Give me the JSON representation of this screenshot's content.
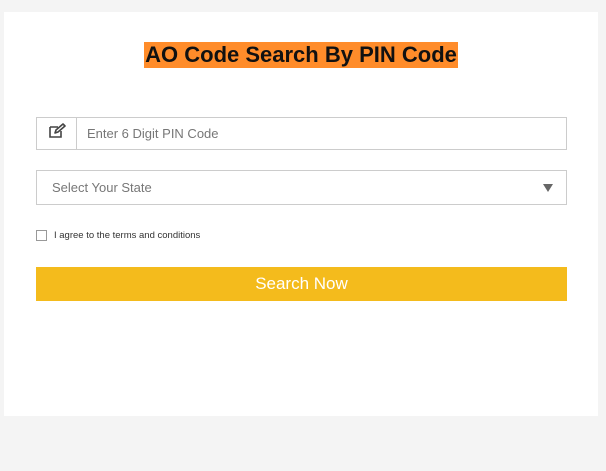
{
  "header": {
    "title": "AO Code Search By PIN Code"
  },
  "form": {
    "pin_placeholder": "Enter 6 Digit PIN Code",
    "pin_icon": "edit-icon",
    "state_select": {
      "selected_label": "Select Your State"
    },
    "terms_label": "I agree to the terms and conditions",
    "terms_checked": false,
    "submit_label": "Search Now"
  },
  "colors": {
    "title_highlight": "#ff8c2a",
    "button": "#f4bb1c",
    "border": "#cccccc"
  }
}
